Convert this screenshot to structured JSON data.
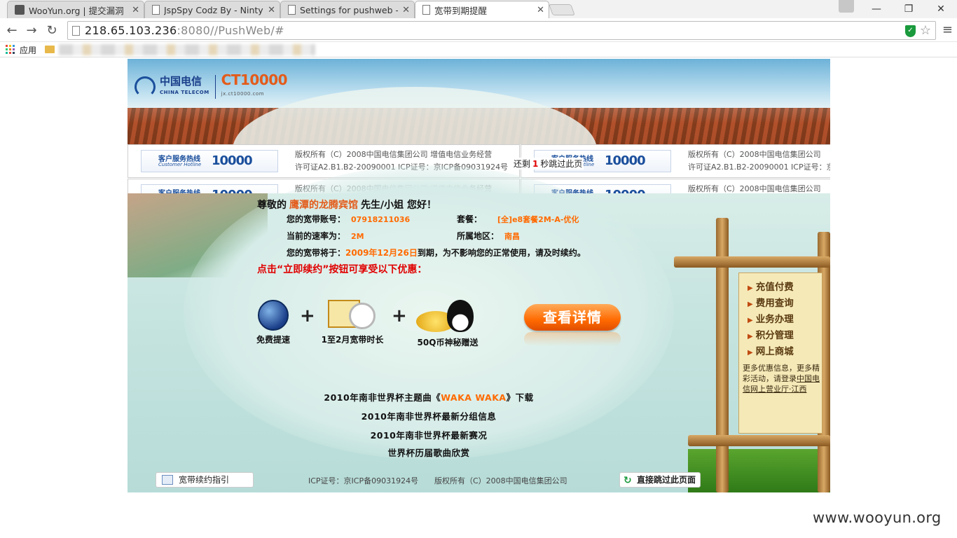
{
  "browser": {
    "tabs": [
      {
        "title": "WooYun.org | 提交漏洞",
        "active": false
      },
      {
        "title": "JspSpy Codz By - Ninty",
        "active": false
      },
      {
        "title": "Settings for pushweb - I",
        "active": false
      },
      {
        "title": "宽带到期提醒",
        "active": true
      }
    ],
    "url_host": "218.65.103.236",
    "url_rest": ":8080//PushWeb/#",
    "bookmarks": {
      "apps_label": "应用"
    }
  },
  "header": {
    "logo_cn": "中国电信",
    "logo_en": "CHINA TELECOM",
    "logo_brand": "CT10000",
    "logo_site": "jx.ct10000.com"
  },
  "footer_strip": {
    "hotline_label": "客户服务热线",
    "hotline_en": "Customer Hotline",
    "hotline_number": "10000",
    "copyright_line1": "版权所有（C）2008中国电信集团公司  增值电信业务经营",
    "copyright_line2": "许可证A2.B1.B2-20090001 ICP证号：京ICP备09031924号",
    "copyright_line1_short": "版权所有（C）2008中国电信集团公司",
    "copyright_line2_short": "许可证A2.B1.B2-20090001 ICP证号：京"
  },
  "redirect": {
    "prefix": "还剩",
    "seconds": "1",
    "suffix": "秒跳过此页"
  },
  "greeting": {
    "prefix": "尊敬的",
    "organization": "鹰潭的龙腾宾馆",
    "suffix": "先生/小姐  您好！"
  },
  "account": {
    "account_label": "您的宽带账号：",
    "account_value": "07918211036",
    "package_label": "套餐：",
    "package_value": "[全]e8套餐2M-A-优化",
    "speed_label": "当前的速率为：",
    "speed_value": "2M",
    "region_label": "所属地区：",
    "region_value": "南昌"
  },
  "expiry": {
    "prefix": "您的宽带将于：",
    "date": "2009年12月26日",
    "suffix": "到期，为不影响您的正常使用，请及时续约。"
  },
  "promo_text": "点击“立即续约”按钮可享受以下优惠：",
  "offers": [
    {
      "icon": "globe-icon",
      "label": "免费提速"
    },
    {
      "icon": "calendar-clock-icon",
      "label": "1至2月宽带时长"
    },
    {
      "icon": "qq-coins-icon",
      "label": "50Q币神秘赠送"
    }
  ],
  "offer_plus": "+",
  "detail_button": "查看详情",
  "links": {
    "wc_song_prefix": "2010年南非世界杯主题曲《",
    "wc_song_name": "WAKA WAKA",
    "wc_song_suffix": "》下载",
    "wc_groups": "2010年南非世界杯最新分组信息",
    "wc_matches": "2010年南非世界杯最新赛况",
    "wc_history": "世界杯历届歌曲欣赏"
  },
  "side_menu": {
    "items": [
      "充值付费",
      "费用查询",
      "业务办理",
      "积分管理",
      "网上商城"
    ],
    "note_prefix": "更多优惠信息，更多精彩活动，请登录",
    "note_link": "中国电信网上营业厅·江西"
  },
  "footer": {
    "guide": "宽带续约指引",
    "icp": "ICP证号：京ICP备09031924号",
    "copyright": "版权所有（C）2008中国电信集团公司",
    "skip": "直接跳过此页面"
  },
  "watermark": "www.wooyun.org"
}
